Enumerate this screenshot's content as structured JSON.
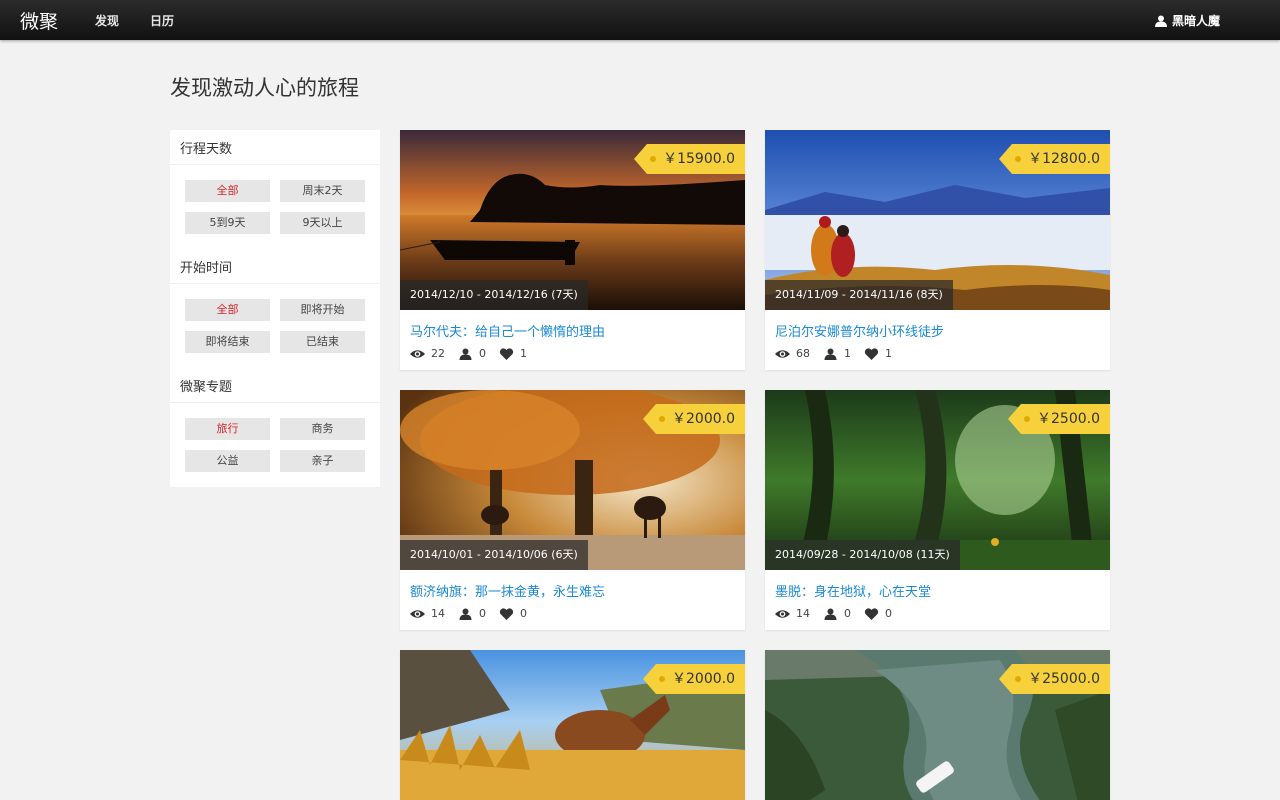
{
  "nav": {
    "brand": "微聚",
    "links": [
      "发现",
      "日历"
    ],
    "user": "黑暗人魔"
  },
  "page_title": "发现激动人心的旅程",
  "sidebar": {
    "groups": [
      {
        "title": "行程天数",
        "options": [
          "全部",
          "周末2天",
          "5到9天",
          "9天以上"
        ],
        "active": 0
      },
      {
        "title": "开始时间",
        "options": [
          "全部",
          "即将开始",
          "即将结束",
          "已结束"
        ],
        "active": 0
      },
      {
        "title": "微聚专题",
        "options": [
          "旅行",
          "商务",
          "公益",
          "亲子"
        ],
        "active": 0
      }
    ]
  },
  "trips": [
    {
      "title": "马尔代夫：给自己一个懒惰的理由",
      "price": "￥15900.0",
      "dates": "2014/12/10 - 2014/12/16 (7天)",
      "views": "22",
      "people": "0",
      "likes": "1"
    },
    {
      "title": "尼泊尔安娜普尔纳小环线徒步",
      "price": "￥12800.0",
      "dates": "2014/11/09 - 2014/11/16 (8天)",
      "views": "68",
      "people": "1",
      "likes": "1"
    },
    {
      "title": "额济纳旗：那一抹金黄，永生难忘",
      "price": "￥2000.0",
      "dates": "2014/10/01 - 2014/10/06 (6天)",
      "views": "14",
      "people": "0",
      "likes": "0"
    },
    {
      "title": "墨脱：身在地狱，心在天堂",
      "price": "￥2500.0",
      "dates": "2014/09/28 - 2014/10/08 (11天)",
      "views": "14",
      "people": "0",
      "likes": "0"
    },
    {
      "title": "",
      "price": "￥2000.0",
      "dates": "",
      "views": "",
      "people": "",
      "likes": ""
    },
    {
      "title": "",
      "price": "￥25000.0",
      "dates": "",
      "views": "",
      "people": "",
      "likes": ""
    }
  ],
  "icons": {
    "eye": "eye-icon",
    "user": "user-icon",
    "heart": "heart-icon"
  },
  "colors": {
    "accent_link": "#1a8ad6",
    "active_filter": "#d6262c",
    "price_tag": "#f6d13b"
  }
}
